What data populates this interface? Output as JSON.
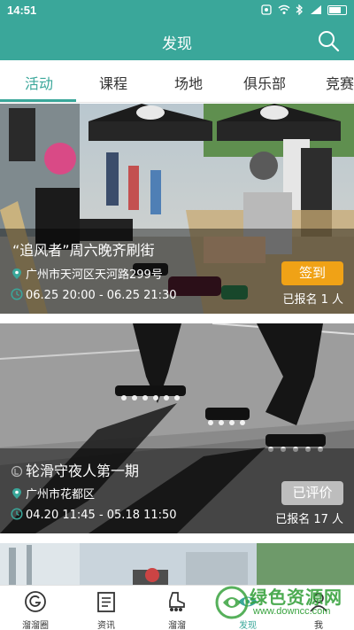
{
  "status_bar": {
    "time": "14:51",
    "icons": [
      "screenshot-icon",
      "wifi-icon",
      "bluetooth-icon",
      "signal-icon",
      "battery-icon"
    ]
  },
  "header": {
    "title": "发现",
    "search_icon": "search-icon"
  },
  "tabs": [
    {
      "label": "活动",
      "active": true
    },
    {
      "label": "课程",
      "active": false
    },
    {
      "label": "场地",
      "active": false
    },
    {
      "label": "俱乐部",
      "active": false
    },
    {
      "label": "竞赛",
      "active": false
    }
  ],
  "events": [
    {
      "title": "“追风者”周六晚齐刷街",
      "location": "广州市天河区天河路299号",
      "time": "06.25 20:00 - 06.25 21:30",
      "action": "签到",
      "signup": "已报名 1 人"
    },
    {
      "title": "轮滑守夜人第一期",
      "location": "广州市花都区",
      "time": "04.20 11:45 - 05.18 11:50",
      "action": "已评价",
      "signup": "已报名 17 人"
    }
  ],
  "bottom_nav": [
    {
      "label": "溜溜圈",
      "icon": "circle-g-icon",
      "active": false
    },
    {
      "label": "资讯",
      "icon": "news-icon",
      "active": false
    },
    {
      "label": "溜溜",
      "icon": "skate-icon",
      "active": false
    },
    {
      "label": "发现",
      "icon": "eye-icon",
      "active": true
    },
    {
      "label": "我",
      "icon": "user-icon",
      "active": false
    }
  ],
  "watermark": {
    "text": "绿色资源网",
    "url": "www.downcc.com"
  },
  "colors": {
    "primary": "#3aa79a",
    "action_orange": "#f0a216",
    "watermark_green": "#39a33f"
  }
}
